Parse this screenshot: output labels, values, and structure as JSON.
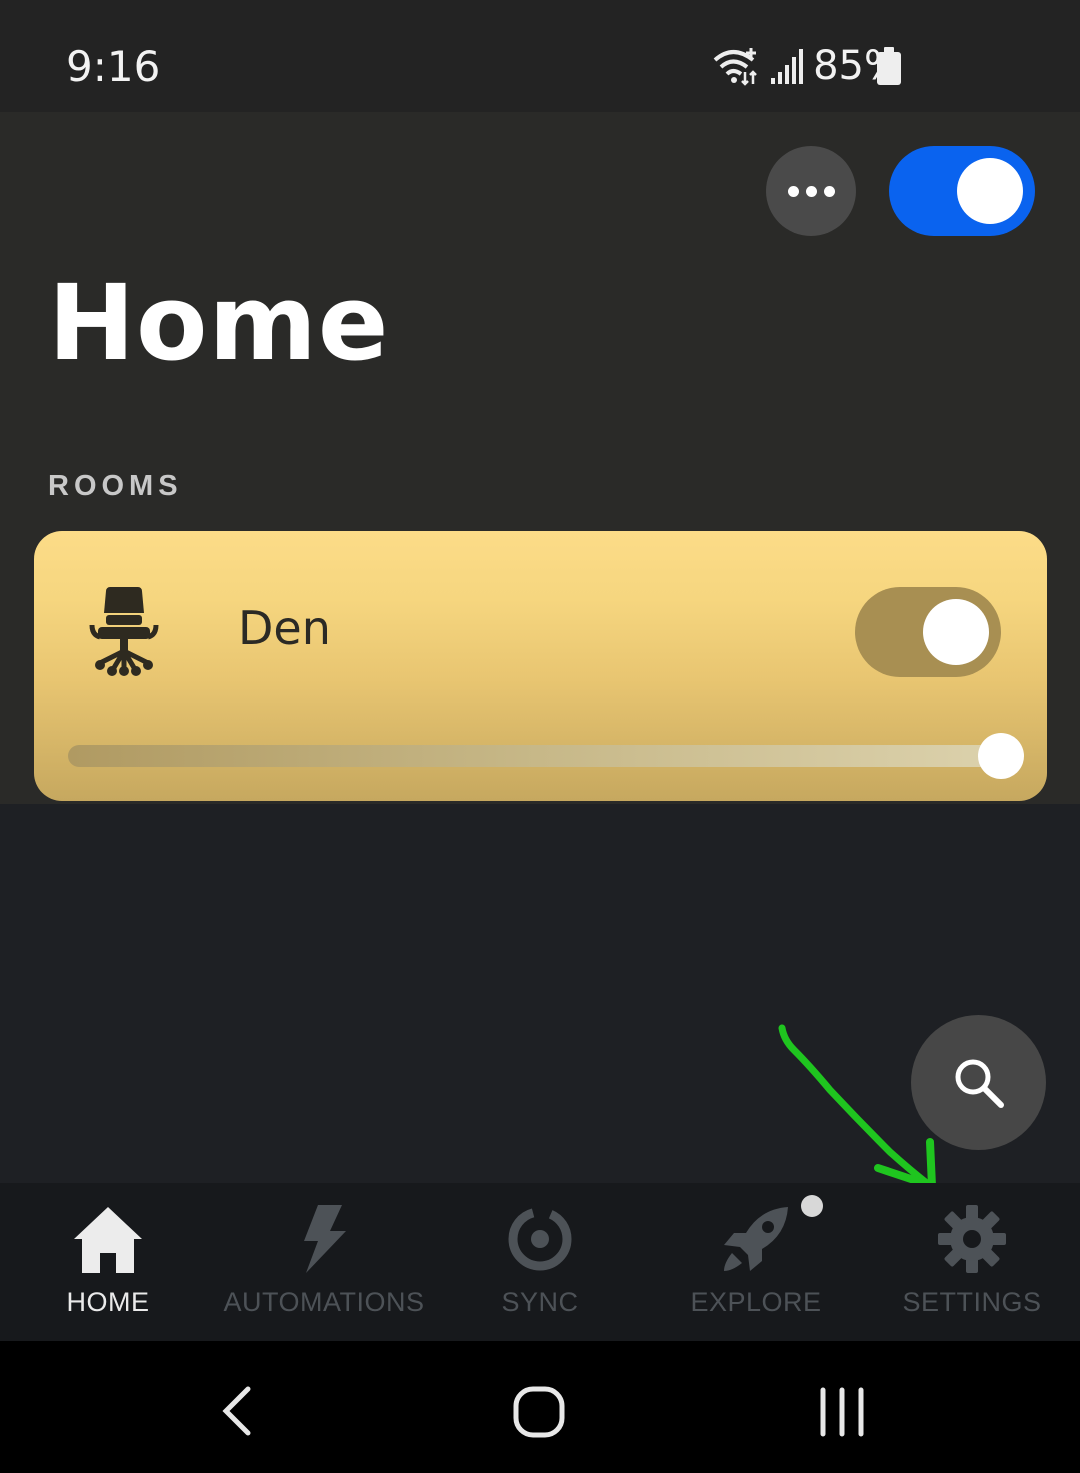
{
  "status_bar": {
    "time": "9:16",
    "battery": "85%",
    "icons": [
      "wifi-icon",
      "signal-icon",
      "battery-icon"
    ]
  },
  "header": {
    "title": "Home",
    "more_icon": "more-horizontal-icon",
    "master_toggle_on": true
  },
  "rooms": {
    "section_label": "ROOMS",
    "items": [
      {
        "name": "Den",
        "icon": "office-chair-icon",
        "toggle_on": true,
        "brightness": 1.0
      }
    ]
  },
  "search_fab": {
    "icon": "search-icon"
  },
  "annotation": {
    "color": "#1fc51f",
    "points_to": "settings"
  },
  "bottom_nav": {
    "items": [
      {
        "label": "HOME",
        "icon": "home-icon",
        "active": true
      },
      {
        "label": "AUTOMATIONS",
        "icon": "lightning-icon",
        "active": false
      },
      {
        "label": "SYNC",
        "icon": "sync-icon",
        "active": false
      },
      {
        "label": "EXPLORE",
        "icon": "rocket-icon",
        "active": false,
        "badge": true
      },
      {
        "label": "SETTINGS",
        "icon": "gear-icon",
        "active": false
      }
    ]
  },
  "system_nav": {
    "icons": [
      "back-icon",
      "home-circle-icon",
      "recents-icon"
    ]
  },
  "colors": {
    "accent": "#0a63ef",
    "room_card": "#f6d67f",
    "active_nav": "#eaeaea",
    "inactive_nav": "#4d5257"
  }
}
